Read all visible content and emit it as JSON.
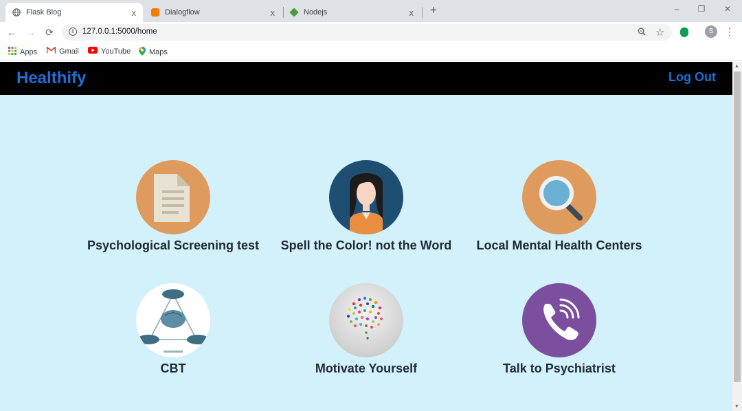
{
  "browser": {
    "tabs": [
      {
        "label": "Flask Blog",
        "active": true,
        "favicon": "globe-icon"
      },
      {
        "label": "Dialogflow",
        "active": false,
        "favicon": "dialogflow-icon"
      },
      {
        "label": "Nodejs",
        "active": false,
        "favicon": "nodejs-icon"
      }
    ],
    "tab_close": "x",
    "new_tab": "+",
    "window_controls": {
      "minimize": "–",
      "restore": "❐",
      "close": "✕"
    },
    "nav": {
      "back": "←",
      "forward": "→",
      "reload": "⟳"
    },
    "url": "127.0.0.1:5000/home",
    "profile_initial": "S",
    "bookmarks": [
      {
        "label": "Apps",
        "icon": "apps-grid-icon"
      },
      {
        "label": "Gmail",
        "icon": "gmail-icon"
      },
      {
        "label": "YouTube",
        "icon": "youtube-icon"
      },
      {
        "label": "Maps",
        "icon": "maps-pin-icon"
      }
    ]
  },
  "navbar": {
    "brand": "Healthify",
    "logout": "Log Out"
  },
  "cards": [
    {
      "label": "Psychological Screening test",
      "icon": "document-icon"
    },
    {
      "label": "Spell the Color! not the Word",
      "icon": "woman-avatar-icon"
    },
    {
      "label": "Local Mental Health Centers",
      "icon": "magnifier-icon"
    },
    {
      "label": "CBT",
      "icon": "brain-diagram-icon"
    },
    {
      "label": "Motivate Yourself",
      "icon": "colorful-brain-icon"
    },
    {
      "label": "Talk to Psychiatrist",
      "icon": "phone-call-icon"
    }
  ],
  "colors": {
    "page_bg": "#d2f1fa",
    "navbar_bg": "#000000",
    "brand": "#1e6fd6",
    "card_label": "#1f2a33",
    "orange_circle": "#df9a5e",
    "navy_circle": "#1f4e73",
    "viber_purple": "#7b4f9d"
  }
}
